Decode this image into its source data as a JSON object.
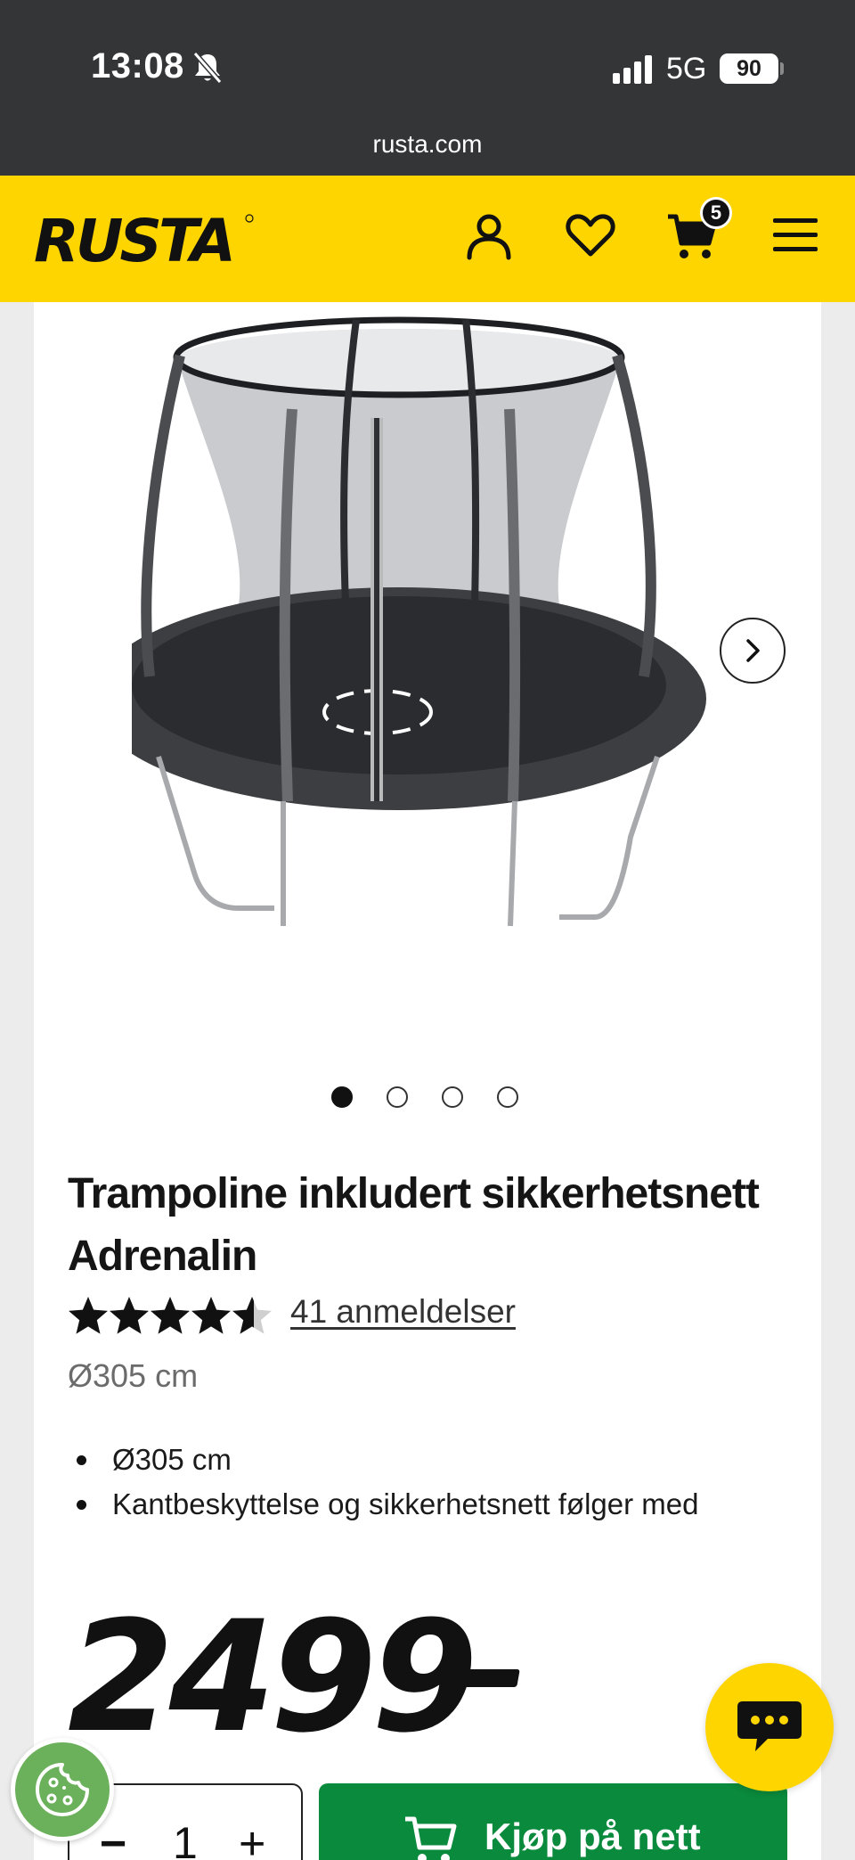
{
  "status_bar": {
    "time": "13:08",
    "network": "5G",
    "battery": "90",
    "url": "rusta.com"
  },
  "header": {
    "logo_text": "RUSTA",
    "cart_count": "5",
    "icons": [
      "account-icon",
      "heart-icon",
      "cart-icon",
      "menu-icon"
    ]
  },
  "product": {
    "title": "Trampoline inkludert sikkerhetsnett Adrenalin",
    "rating": 4.5,
    "reviews_label": "41 anmeldelser",
    "size_label": "Ø305 cm",
    "bullets": [
      "Ø305 cm",
      "Kantbeskyttelse og sikkerhetsnett følger med"
    ],
    "price": "2499",
    "image_count": 4,
    "active_image": 1
  },
  "purchase": {
    "minus": "−",
    "quantity": "1",
    "plus": "+",
    "buy_label": "Kjøp på nett"
  },
  "colors": {
    "brand_yellow": "#ffd500",
    "buy_green": "#0a8a3c",
    "status_bar": "#333537"
  }
}
